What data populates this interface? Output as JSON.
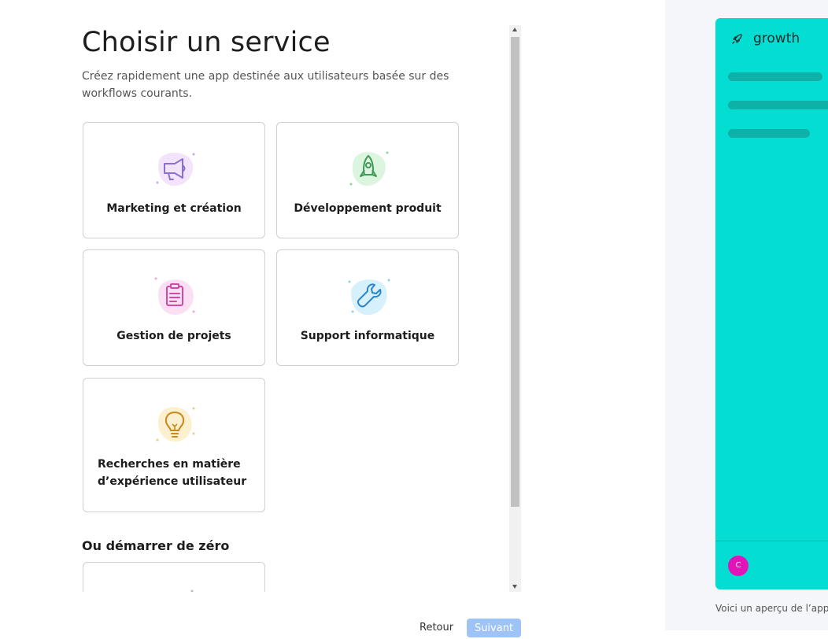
{
  "page": {
    "title": "Choisir un service",
    "subtitle": "Créez rapidement une app destinée aux utilisateurs basée sur des workflows courants."
  },
  "services": [
    {
      "label": "Marketing et création",
      "icon": "megaphone-icon",
      "color": "#8b6fd6",
      "blob": "#f3e3fb"
    },
    {
      "label": "Développement produit",
      "icon": "rocket-icon",
      "color": "#3f9a57",
      "blob": "#dcf5df"
    },
    {
      "label": "Gestion de projets",
      "icon": "clipboard-icon",
      "color": "#d04aa6",
      "blob": "#fbe0f4"
    },
    {
      "label": "Support informatique",
      "icon": "wrench-icon",
      "color": "#2e84c9",
      "blob": "#d6f1fb"
    },
    {
      "label": "Recherches en matière d’expérience utilisateur",
      "icon": "lightbulb-icon",
      "color": "#c8881a",
      "blob": "#fdf0cf"
    }
  ],
  "scratch": {
    "title": "Ou démarrer de zéro"
  },
  "footer": {
    "back_label": "Retour",
    "next_label": "Suivant"
  },
  "preview": {
    "app_name": "growth",
    "avatar_letter": "C",
    "caption": "Voici un aperçu de l’app.",
    "accent": "#03ddd2"
  }
}
